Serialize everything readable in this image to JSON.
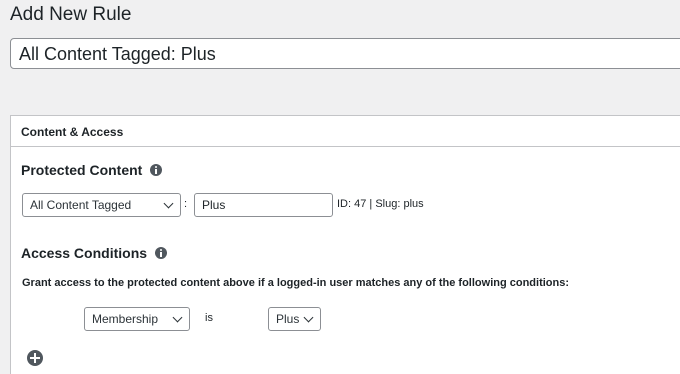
{
  "page": {
    "title": "Add New Rule"
  },
  "rule": {
    "title_value": "All Content Tagged: Plus"
  },
  "metabox": {
    "heading": "Content & Access",
    "protected_content": {
      "heading": "Protected Content",
      "type_select": "All Content Tagged",
      "separator": ":",
      "tag_value": "Plus",
      "meta": "ID: 47 | Slug: plus"
    },
    "access_conditions": {
      "heading": "Access Conditions",
      "description": "Grant access to the protected content above if a logged-in user matches any of the following conditions:",
      "condition": {
        "type_select": "Membership",
        "operator": "is",
        "value_select": "Plus"
      }
    }
  }
}
